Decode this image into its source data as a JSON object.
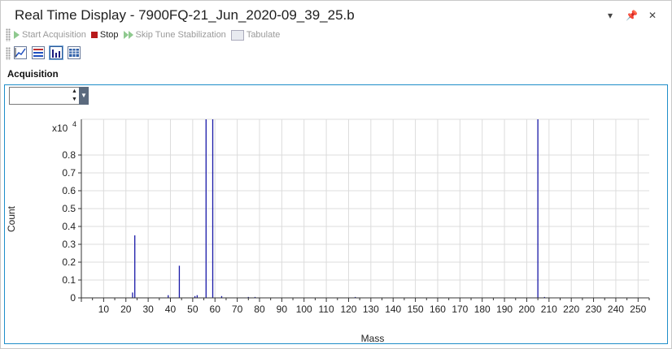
{
  "window": {
    "title": "Real Time Display - 7900FQ-21_Jun_2020-09_39_25.b"
  },
  "toolbar": {
    "start_label": "Start Acquisition",
    "stop_label": "Stop",
    "skip_label": "Skip Tune Stabilization",
    "tabulate_label": "Tabulate"
  },
  "view_toolbar": {
    "icons": [
      "line-chart-icon",
      "table-chart-icon",
      "bar-spectrum-icon",
      "grid-view-icon"
    ],
    "active_index": 2
  },
  "acquisition": {
    "label": "Acquisition",
    "spinner_value": ""
  },
  "chart_data": {
    "type": "bar",
    "xlabel": "Mass",
    "ylabel": "Count",
    "multiplier_label": "x10",
    "multiplier_exp": "4",
    "xlim": [
      0,
      255
    ],
    "ylim": [
      0,
      1.0
    ],
    "x_ticks": [
      10,
      20,
      30,
      40,
      50,
      60,
      70,
      80,
      90,
      100,
      110,
      120,
      130,
      140,
      150,
      160,
      170,
      180,
      190,
      200,
      210,
      220,
      230,
      240,
      250
    ],
    "y_ticks": [
      0,
      0.1,
      0.2,
      0.3,
      0.4,
      0.5,
      0.6,
      0.7,
      0.8
    ],
    "y_tick_labels": [
      "0",
      "0.1",
      "0.2",
      "0.3",
      "0.4",
      "0.5",
      "0.6",
      "0.7",
      "0.8"
    ],
    "grid": true,
    "bar_color": "#1a1aa8",
    "peaks": [
      {
        "x": 23,
        "y": 0.03
      },
      {
        "x": 24,
        "y": 0.35
      },
      {
        "x": 39,
        "y": 0.015
      },
      {
        "x": 44,
        "y": 0.18
      },
      {
        "x": 51,
        "y": 0.01
      },
      {
        "x": 52,
        "y": 0.015
      },
      {
        "x": 56,
        "y": 1.0
      },
      {
        "x": 59,
        "y": 1.0
      },
      {
        "x": 63,
        "y": 0.01
      },
      {
        "x": 75,
        "y": 0.005
      },
      {
        "x": 78,
        "y": 0.005
      },
      {
        "x": 123,
        "y": 0.005
      },
      {
        "x": 205,
        "y": 1.0
      },
      {
        "x": 208,
        "y": 0.005
      }
    ]
  }
}
